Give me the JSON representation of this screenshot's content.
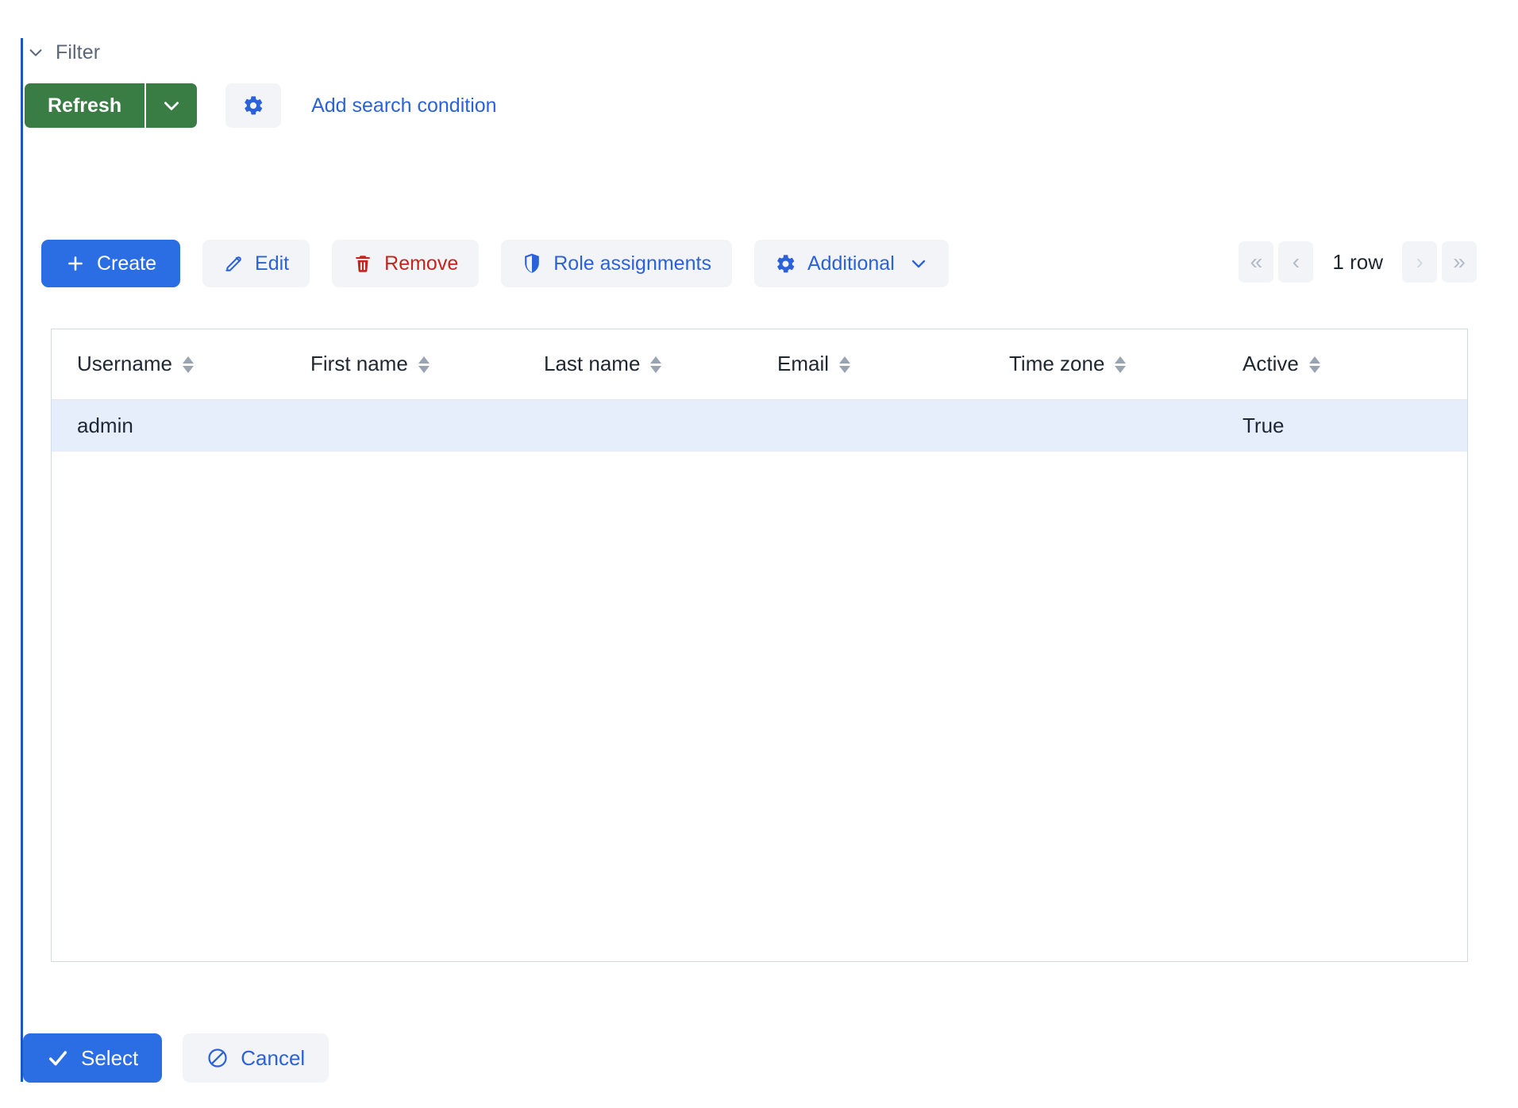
{
  "filter": {
    "label": "Filter",
    "chevron_icon": "chevron-down-icon"
  },
  "refresh": {
    "label": "Refresh",
    "dropdown_icon": "chevron-down-icon",
    "color": "#3a7d44"
  },
  "search": {
    "settings_icon": "gear-icon",
    "add_condition_label": "Add search condition",
    "link_color": "#2b62d9"
  },
  "toolbar": {
    "create_label": "Create",
    "create_icon": "plus-icon",
    "edit_label": "Edit",
    "edit_icon": "pencil-icon",
    "remove_label": "Remove",
    "remove_icon": "trash-icon",
    "role_assignments_label": "Role assignments",
    "role_assignments_icon": "shield-icon",
    "additional_label": "Additional",
    "additional_icon": "gear-icon",
    "additional_chevron_icon": "chevron-down-icon",
    "primary_color": "#2b6ee4",
    "danger_color": "#c4261d"
  },
  "pagination": {
    "first_icon": "«",
    "prev_icon": "‹",
    "count_label": "1 row",
    "next_icon": "›",
    "last_icon": "»"
  },
  "table": {
    "columns": [
      {
        "label": "Username",
        "sort_icon": "sort-icon"
      },
      {
        "label": "First name",
        "sort_icon": "sort-icon"
      },
      {
        "label": "Last name",
        "sort_icon": "sort-icon"
      },
      {
        "label": "Email",
        "sort_icon": "sort-icon"
      },
      {
        "label": "Time zone",
        "sort_icon": "sort-icon"
      },
      {
        "label": "Active",
        "sort_icon": "sort-icon"
      }
    ],
    "rows": [
      {
        "selected": true,
        "cells": [
          "admin",
          "",
          "",
          "",
          "",
          "True"
        ]
      }
    ],
    "selected_row_color": "#e7eefb"
  },
  "footer": {
    "select_label": "Select",
    "select_icon": "check-icon",
    "cancel_label": "Cancel",
    "cancel_icon": "block-icon"
  }
}
